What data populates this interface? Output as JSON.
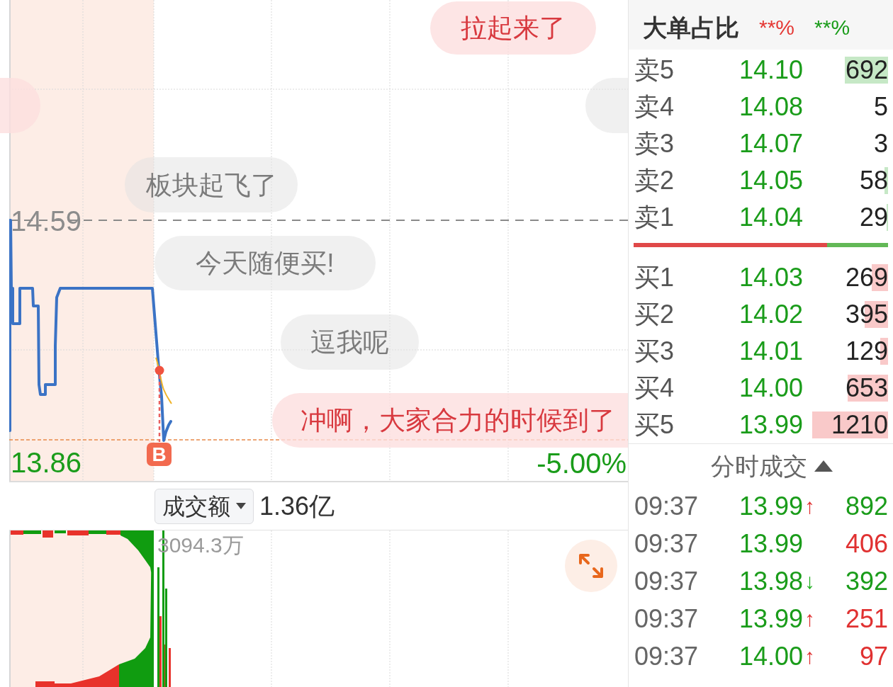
{
  "price_chart": {
    "comments": [
      {
        "kind": "highlight",
        "text": "拉起来了"
      },
      {
        "kind": "highlight"
      },
      {
        "kind": "normal"
      },
      {
        "kind": "normal",
        "text": "板块起飞了"
      },
      {
        "kind": "normal",
        "text": "今天随便买!"
      },
      {
        "kind": "normal",
        "text": "逗我呢"
      },
      {
        "kind": "highlight",
        "text": "冲啊，大家合力的时候到了"
      }
    ],
    "high_label": "14.59",
    "low_label": "13.86",
    "change_label": "-5.00%",
    "trade_marker": "B"
  },
  "volume_toolbar": {
    "metric": "成交额",
    "total": "1.36亿"
  },
  "volume_chart": {
    "max_label": "3094.3万"
  },
  "order_book": {
    "title": "大单占比",
    "ratios": [
      {
        "text": "**%",
        "color": "#e53935"
      },
      {
        "text": "**%",
        "color": "#1a9c1a"
      }
    ],
    "asks": [
      {
        "label": "卖5",
        "price": "14.10",
        "volume": "692",
        "level": 0.51
      },
      {
        "label": "卖4",
        "price": "14.08",
        "volume": "5"
      },
      {
        "label": "卖3",
        "price": "14.07",
        "volume": "3"
      },
      {
        "label": "卖2",
        "price": "14.05",
        "volume": "58",
        "level": 0.04
      },
      {
        "label": "卖1",
        "price": "14.04",
        "volume": "29",
        "level": 0.02
      }
    ],
    "balance": {
      "level": 0.76
    },
    "bids": [
      {
        "label": "买1",
        "price": "14.03",
        "volume": "269",
        "level": 0.19
      },
      {
        "label": "买2",
        "price": "14.02",
        "volume": "395",
        "level": 0.28
      },
      {
        "label": "买3",
        "price": "14.01",
        "volume": "129",
        "level": 0.09
      },
      {
        "label": "买4",
        "price": "14.00",
        "volume": "653",
        "level": 0.48
      },
      {
        "label": "买5",
        "price": "13.99",
        "volume": "1210",
        "level": 0.89
      }
    ]
  },
  "trades": {
    "title": "分时成交",
    "rows": [
      {
        "time": "09:37",
        "price": "13.99",
        "arrow": {
          "text": "↑",
          "color": "#e03131"
        },
        "volume": "892",
        "color": "#1a9c1a"
      },
      {
        "time": "09:37",
        "price": "13.99",
        "volume": "406",
        "color": "#e03131"
      },
      {
        "time": "09:37",
        "price": "13.98",
        "arrow": {
          "text": "↓",
          "color": "#22b022"
        },
        "volume": "392",
        "color": "#1a9c1a"
      },
      {
        "time": "09:37",
        "price": "13.99",
        "arrow": {
          "text": "↑",
          "color": "#e03131"
        },
        "volume": "251",
        "color": "#e03131"
      },
      {
        "time": "09:37",
        "price": "14.00",
        "arrow": {
          "text": "↑",
          "color": "#e03131"
        },
        "volume": "97",
        "color": "#e03131"
      }
    ]
  }
}
